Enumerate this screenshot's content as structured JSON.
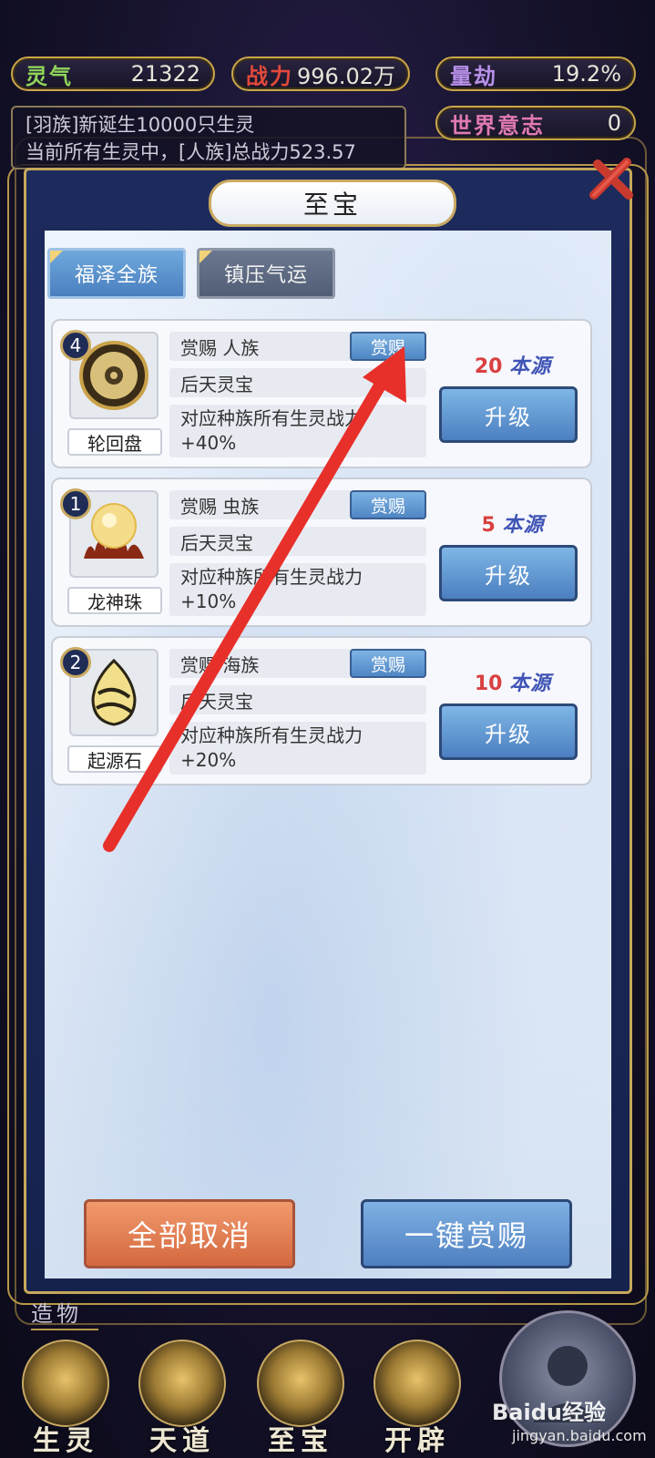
{
  "stats": {
    "lingqi": {
      "label": "灵气",
      "value": "21322"
    },
    "zhanli": {
      "label": "战力",
      "value": "996.02万"
    },
    "liangjie": {
      "label": "量劫",
      "value": "19.2%"
    },
    "shijie": {
      "label": "世界意志",
      "value": "0"
    }
  },
  "news": {
    "line1": "[羽族]新诞生10000只生灵",
    "line2": "当前所有生灵中，[人族]总战力523.57"
  },
  "panel": {
    "title": "至宝"
  },
  "tabs": [
    {
      "label": "福泽全族",
      "active": true
    },
    {
      "label": "镇压气运",
      "active": false
    }
  ],
  "items": [
    {
      "level": "4",
      "name": "轮回盘",
      "reward_target": "赏赐  人族",
      "reward_button": "赏赐",
      "type": "后天灵宝",
      "desc": "对应种族所有生灵战力+40%",
      "cost_amount": "20",
      "cost_unit": "本源",
      "upgrade_label": "升级"
    },
    {
      "level": "1",
      "name": "龙神珠",
      "reward_target": "赏赐  虫族",
      "reward_button": "赏赐",
      "type": "后天灵宝",
      "desc": "对应种族所有生灵战力+10%",
      "cost_amount": "5",
      "cost_unit": "本源",
      "upgrade_label": "升级"
    },
    {
      "level": "2",
      "name": "起源石",
      "reward_target": "赏赐  海族",
      "reward_button": "赏赐",
      "type": "后天灵宝",
      "desc": "对应种族所有生灵战力+20%",
      "cost_amount": "10",
      "cost_unit": "本源",
      "upgrade_label": "升级"
    }
  ],
  "bottom": {
    "cancel_all": "全部取消",
    "reward_all": "一键赏赐"
  },
  "zaowu": "造物",
  "nav": [
    {
      "label": "生灵"
    },
    {
      "label": "天道"
    },
    {
      "label": "至宝"
    },
    {
      "label": "开辟"
    }
  ],
  "watermark": {
    "brand": "Baidu经验",
    "url": "jingyan.baidu.com"
  },
  "colors": {
    "gold": "#c9a962",
    "panel_blue": "#1d2a5c",
    "arrow_red": "#e8302a",
    "cost_red": "#d94040"
  }
}
